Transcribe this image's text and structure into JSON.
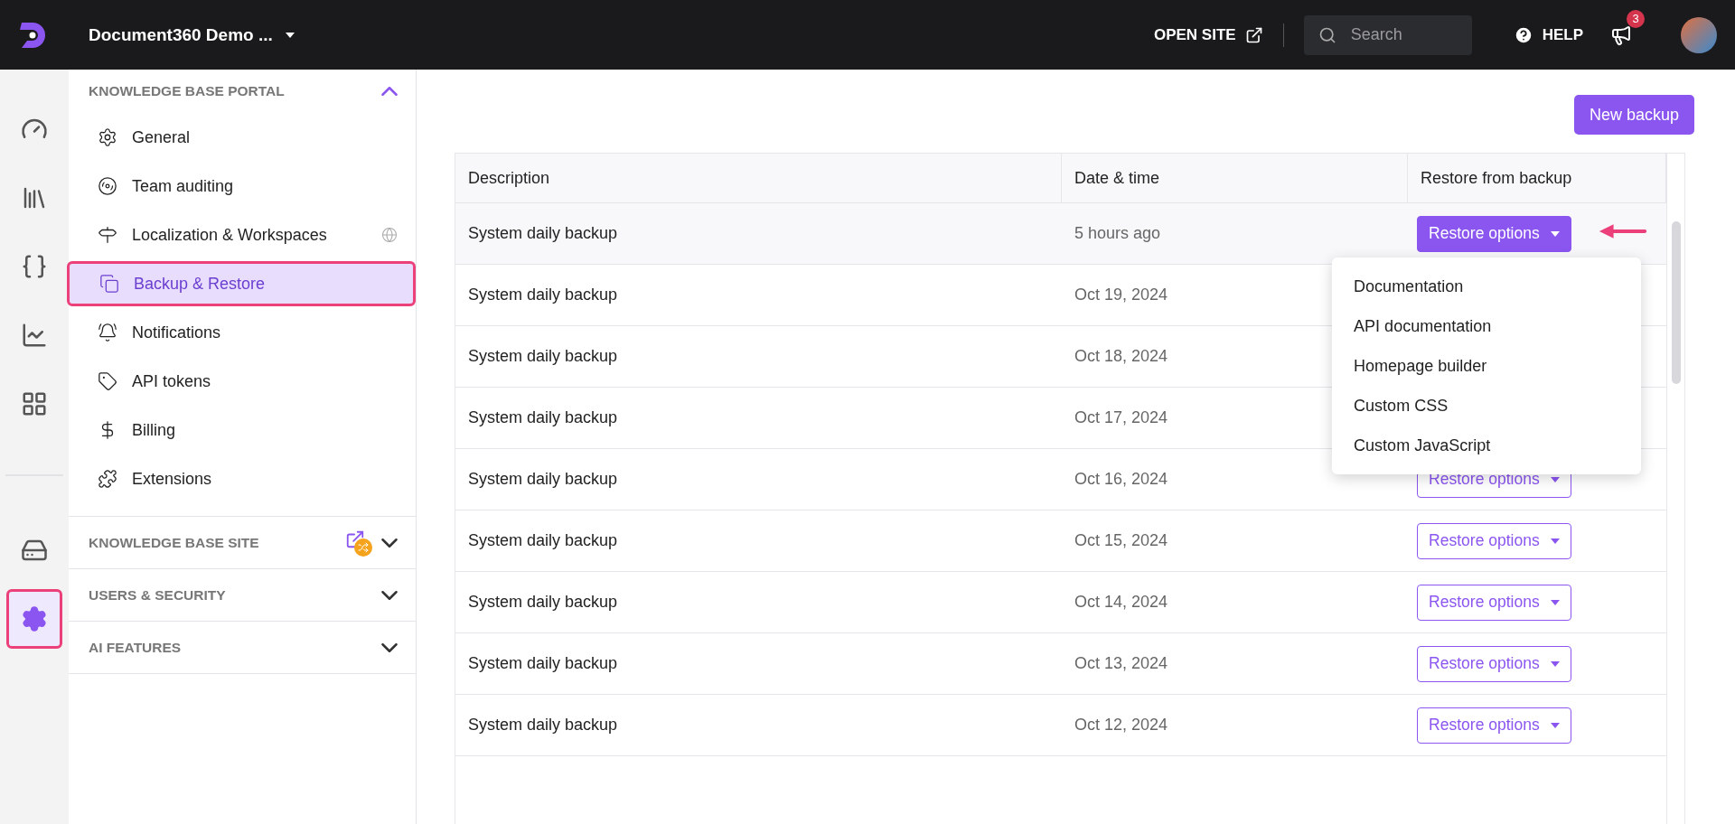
{
  "topbar": {
    "project": "Document360 Demo ...",
    "open_site": "OPEN SITE",
    "search": {
      "placeholder": "Search"
    },
    "help": "HELP",
    "notification_count": "3"
  },
  "rail": [
    {
      "selected": false
    },
    {
      "selected": false
    },
    {
      "selected": false
    },
    {
      "selected": false
    },
    {
      "selected": false
    },
    {
      "selected": false
    },
    {
      "selected": true
    }
  ],
  "sidebar": {
    "sections": [
      {
        "title": "KNOWLEDGE BASE PORTAL",
        "expanded": true,
        "items": [
          {
            "label": "General",
            "selected": false
          },
          {
            "label": "Team auditing",
            "selected": false
          },
          {
            "label": "Localization & Workspaces",
            "selected": false
          },
          {
            "label": "Backup & Restore",
            "selected": true
          },
          {
            "label": "Notifications",
            "selected": false
          },
          {
            "label": "API tokens",
            "selected": false
          },
          {
            "label": "Billing",
            "selected": false
          },
          {
            "label": "Extensions",
            "selected": false
          }
        ]
      },
      {
        "title": "KNOWLEDGE BASE SITE",
        "expanded": false
      },
      {
        "title": "USERS & SECURITY",
        "expanded": false
      },
      {
        "title": "AI FEATURES",
        "expanded": false
      }
    ]
  },
  "new_backup": "New backup",
  "table": {
    "columns": [
      "Description",
      "Date & time",
      "Restore from backup"
    ],
    "rows": [
      {
        "description": "System daily backup",
        "date": "5 hours ago",
        "action": {
          "label": "Restore options",
          "open": true
        }
      },
      {
        "description": "System daily backup",
        "date": "Oct 19, 2024"
      },
      {
        "description": "System daily backup",
        "date": "Oct 18, 2024"
      },
      {
        "description": "System daily backup",
        "date": "Oct 17, 2024"
      },
      {
        "description": "System daily backup",
        "date": "Oct 16, 2024",
        "action": {
          "label": "Restore options",
          "open": false
        }
      },
      {
        "description": "System daily backup",
        "date": "Oct 15, 2024",
        "action": {
          "label": "Restore options",
          "open": false
        }
      },
      {
        "description": "System daily backup",
        "date": "Oct 14, 2024",
        "action": {
          "label": "Restore options",
          "open": false
        }
      },
      {
        "description": "System daily backup",
        "date": "Oct 13, 2024",
        "action": {
          "label": "Restore options",
          "open": false
        }
      },
      {
        "description": "System daily backup",
        "date": "Oct 12, 2024",
        "action": {
          "label": "Restore options",
          "open": false
        }
      }
    ]
  },
  "restore_menu": [
    "Documentation",
    "API documentation",
    "Homepage builder",
    "Custom CSS",
    "Custom JavaScript"
  ]
}
